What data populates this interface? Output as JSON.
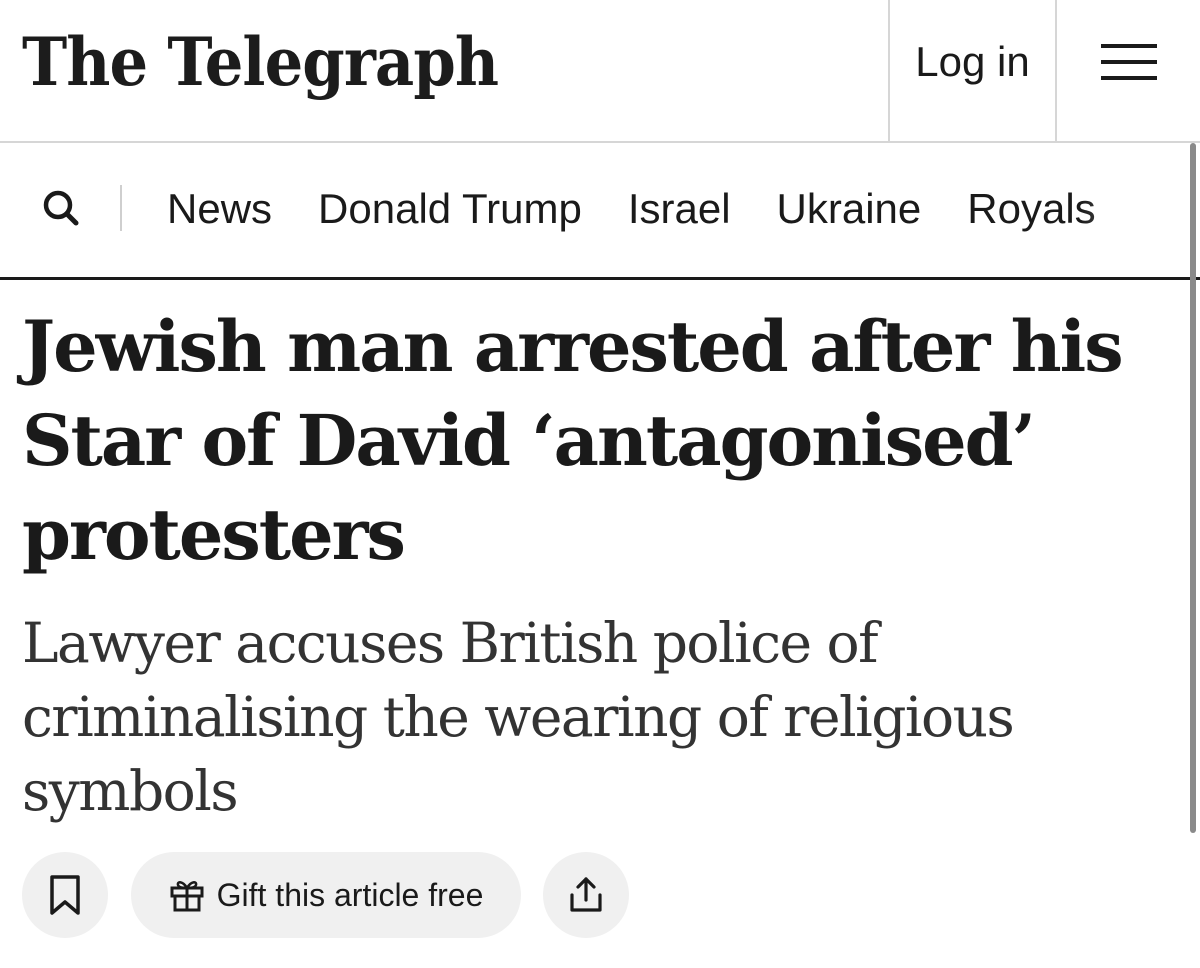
{
  "header": {
    "logo": "The Telegraph",
    "login_label": "Log in"
  },
  "nav": {
    "items": [
      "News",
      "Donald Trump",
      "Israel",
      "Ukraine",
      "Royals"
    ]
  },
  "article": {
    "headline": "Jewish man arrested after his Star of David ‘antagonised’ protesters",
    "standfirst": "Lawyer accuses British police of criminalising the wearing of religious symbols"
  },
  "actions": {
    "gift_label": "Gift this article free"
  },
  "icons": {
    "search": "search-icon",
    "menu": "hamburger-menu-icon",
    "bookmark": "bookmark-icon",
    "gift": "gift-icon",
    "share": "share-icon"
  },
  "colors": {
    "text": "#1a1a1a",
    "standfirst": "#333333",
    "divider": "#d6d6d6",
    "button_bg": "#f0f0f0"
  }
}
